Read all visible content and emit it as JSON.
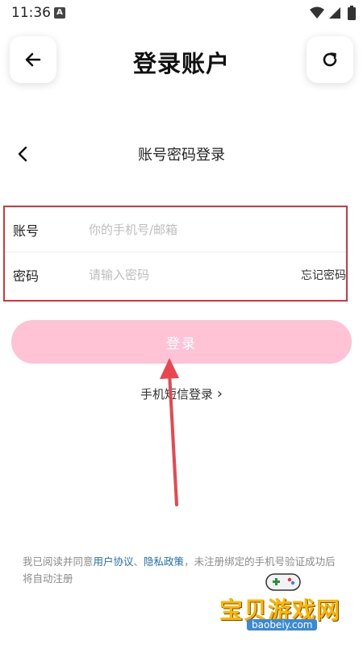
{
  "status_bar": {
    "time": "11:36",
    "notification_letter": "A"
  },
  "header": {
    "title": "登录账户"
  },
  "sub_header": {
    "title": "账号密码登录"
  },
  "form": {
    "account": {
      "label": "账号",
      "placeholder": "你的手机号/邮箱",
      "value": ""
    },
    "password": {
      "label": "密码",
      "placeholder": "请输入密码",
      "value": "",
      "forgot": "忘记密码"
    }
  },
  "login_button": {
    "label": "登录"
  },
  "sms_login": {
    "label": "手机短信登录",
    "chevron": "›"
  },
  "agreement": {
    "prefix": "我已阅读并同意",
    "user_agreement": "用户协议",
    "separator": "、",
    "privacy_policy": "隐私政策",
    "suffix": "，未注册绑定的手机号验证成功后将自动注册"
  },
  "watermark": {
    "name": "宝贝游戏网",
    "url": "baobeiy.com"
  },
  "colors": {
    "login_button": "#ffc3d5",
    "link": "#1e6fb8",
    "highlight_border": "#e0333b",
    "arrow": "#e8474f"
  }
}
